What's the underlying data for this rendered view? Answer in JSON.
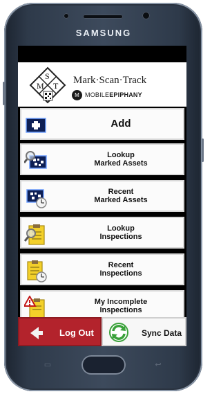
{
  "device": {
    "brand": "SAMSUNG"
  },
  "app": {
    "logo_letters": [
      "M",
      "S",
      "T"
    ],
    "title": "Mark·Scan·Track",
    "publisher_prefix": "MOBILE",
    "publisher_suffix": "EPIPHANY",
    "publisher_badge": "M"
  },
  "menu": [
    {
      "label": "Add",
      "icon": "add-plus-icon"
    },
    {
      "label": "Lookup\nMarked Assets",
      "icon": "lookup-marked-assets-icon"
    },
    {
      "label": "Recent\nMarked Assets",
      "icon": "recent-marked-assets-icon"
    },
    {
      "label": "Lookup\nInspections",
      "icon": "lookup-inspections-icon"
    },
    {
      "label": "Recent\nInspections",
      "icon": "recent-inspections-icon"
    },
    {
      "label": "My Incomplete\nInspections",
      "icon": "incomplete-inspections-icon"
    }
  ],
  "bottom": {
    "logout_label": "Log Out",
    "sync_label": "Sync Data"
  },
  "colors": {
    "logout_bg": "#b3232c",
    "sync_green": "#3aa13a",
    "icon_blue": "#1a3a9a",
    "clipboard_yellow": "#f3d02a"
  }
}
